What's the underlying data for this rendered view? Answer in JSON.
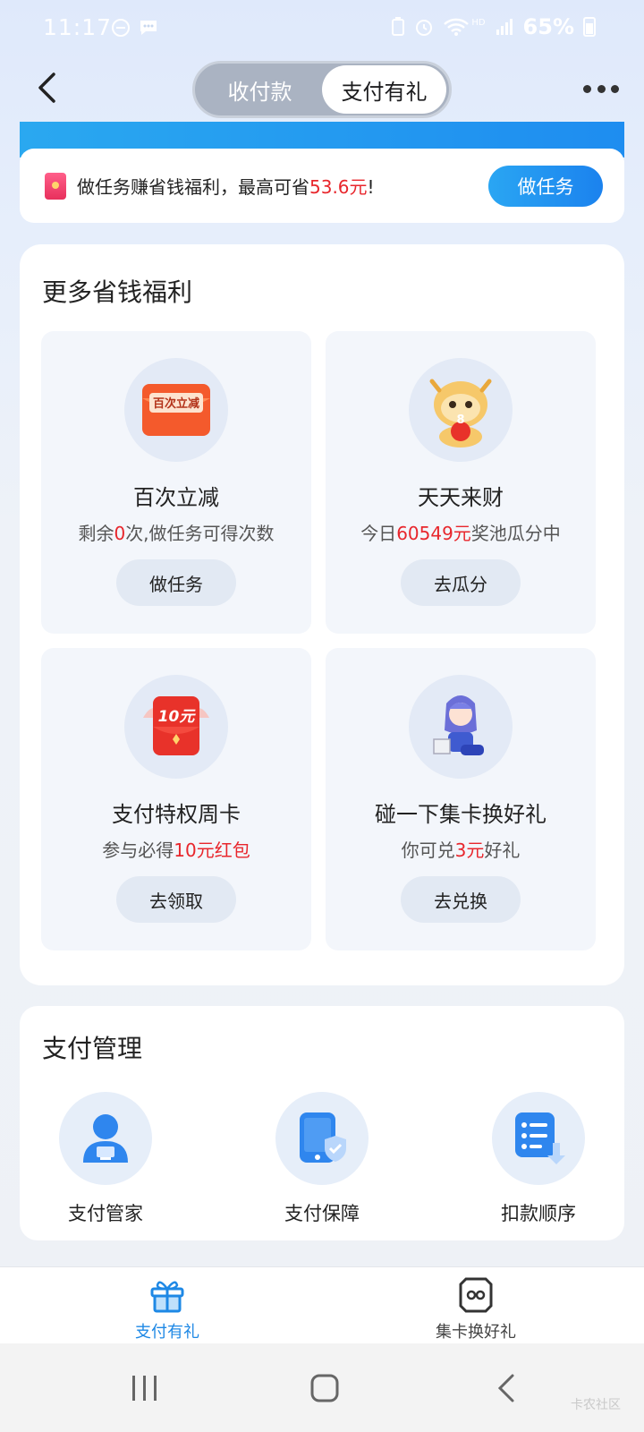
{
  "status_bar": {
    "time": "11:17",
    "battery": "65%",
    "network": "HD"
  },
  "header": {
    "tabs": [
      {
        "label": "收付款",
        "active": false
      },
      {
        "label": "支付有礼",
        "active": true
      }
    ]
  },
  "task_banner": {
    "text_prefix": "做任务赚省钱福利，最高可省",
    "amount": "53.6元",
    "text_suffix": "!",
    "button_label": "做任务"
  },
  "welfare": {
    "title": "更多省钱福利",
    "tiles": [
      {
        "title": "百次立减",
        "sub_pre": "剩余",
        "sub_hl": "0",
        "sub_post": "次,做任务可得次数",
        "button": "做任务",
        "icon": "red-envelope-icon",
        "icon_text": "百次立减"
      },
      {
        "title": "天天来财",
        "sub_pre": "今日",
        "sub_hl": "60549元",
        "sub_post": "奖池瓜分中",
        "button": "去瓜分",
        "icon": "dragon-mascot-icon",
        "icon_text": "8"
      },
      {
        "title": "支付特权周卡",
        "sub_pre": "参与必得",
        "sub_hl": "10元红包",
        "sub_post": "",
        "button": "去领取",
        "icon": "red-packet-icon",
        "icon_text": "10元"
      },
      {
        "title": "碰一下集卡换好礼",
        "sub_pre": "你可兑",
        "sub_hl": "3元",
        "sub_post": "好礼",
        "button": "去兑换",
        "icon": "character-figure-icon",
        "icon_text": ""
      }
    ]
  },
  "manage": {
    "title": "支付管理",
    "items": [
      {
        "label": "支付管家",
        "icon": "butler-icon"
      },
      {
        "label": "支付保障",
        "icon": "shield-phone-icon"
      },
      {
        "label": "扣款顺序",
        "icon": "deduction-order-icon"
      }
    ]
  },
  "tabbar": {
    "items": [
      {
        "label": "支付有礼",
        "active": true
      },
      {
        "label": "集卡换好礼",
        "active": false
      }
    ]
  },
  "watermark": "卡农社区",
  "colors": {
    "accent_blue": "#1e88e5",
    "highlight_red": "#e8262c"
  }
}
